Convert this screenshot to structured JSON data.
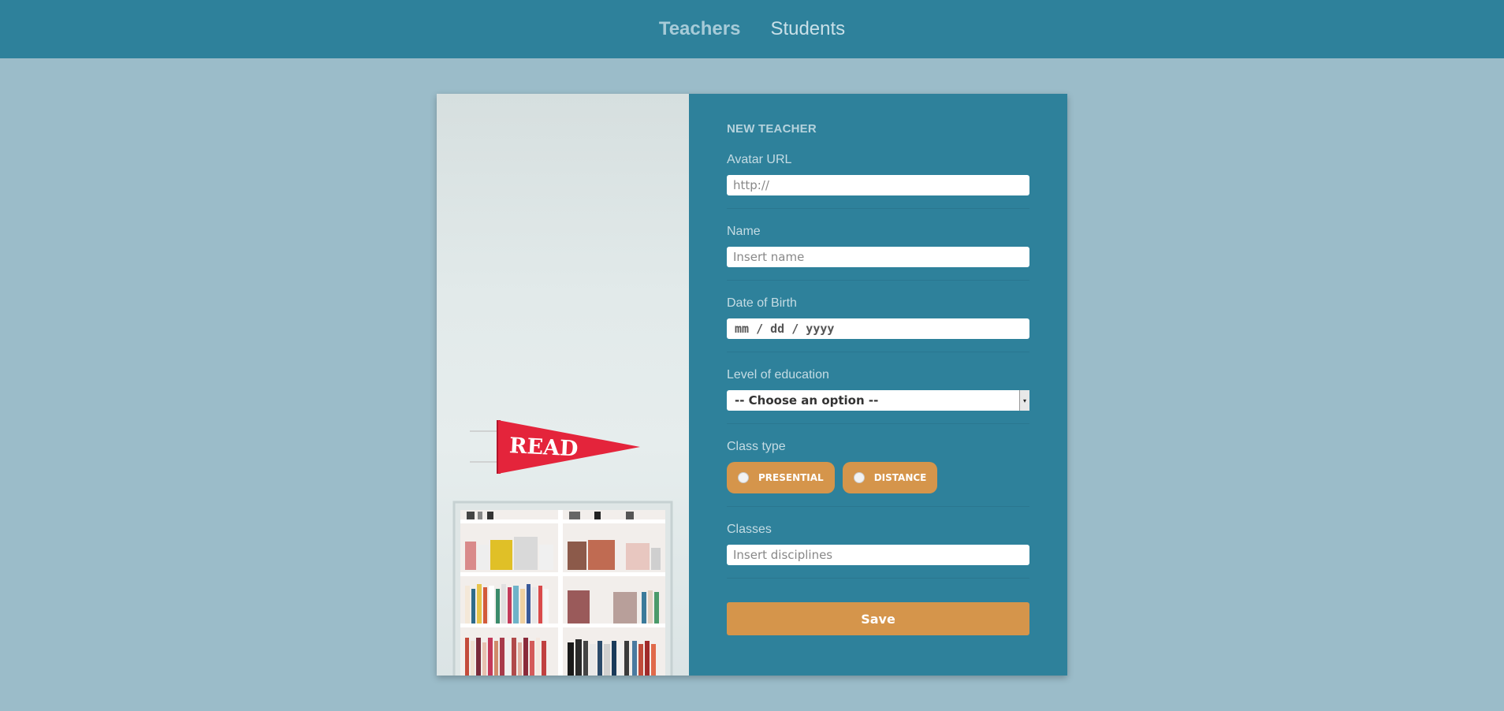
{
  "nav": {
    "items": [
      {
        "label": "Teachers",
        "active": true
      },
      {
        "label": "Students",
        "active": false
      }
    ]
  },
  "form": {
    "title": "NEW TEACHER",
    "avatar": {
      "label": "Avatar URL",
      "placeholder": "http://"
    },
    "name": {
      "label": "Name",
      "placeholder": "Insert name"
    },
    "dob": {
      "label": "Date of Birth",
      "placeholder": "mm / dd / yyyy"
    },
    "education": {
      "label": "Level of education",
      "selected": "-- Choose an option --"
    },
    "class_type": {
      "label": "Class type",
      "options": [
        "PRESENTIAL",
        "DISTANCE"
      ]
    },
    "classes": {
      "label": "Classes",
      "placeholder": "Insert disciplines"
    },
    "save_label": "Save"
  },
  "image": {
    "pennant_text": "READ"
  },
  "colors": {
    "background": "#9bbcc9",
    "primary": "#2e819b",
    "accent": "#d5954b"
  }
}
